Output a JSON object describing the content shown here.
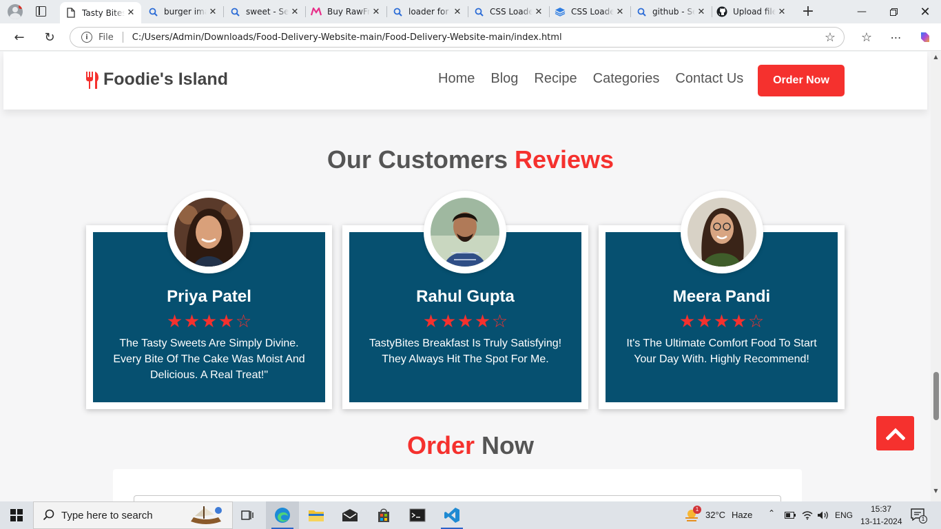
{
  "browser": {
    "tabs": [
      {
        "title": "Tasty Bites",
        "icon": "page-icon",
        "active": true
      },
      {
        "title": "burger ima",
        "icon": "search-icon"
      },
      {
        "title": "sweet - Se",
        "icon": "search-icon"
      },
      {
        "title": "Buy RawFr",
        "icon": "myntra-icon"
      },
      {
        "title": "loader for",
        "icon": "search-icon"
      },
      {
        "title": "CSS Loade",
        "icon": "search-icon"
      },
      {
        "title": "CSS Loade",
        "icon": "layers-icon"
      },
      {
        "title": "github - Se",
        "icon": "search-icon"
      },
      {
        "title": "Upload file",
        "icon": "github-icon"
      }
    ],
    "address": {
      "scheme_label": "File",
      "url": "C:/Users/Admin/Downloads/Food-Delivery-Website-main/Food-Delivery-Website-main/index.html"
    }
  },
  "site": {
    "logo_text": "Foodie's Island",
    "nav": [
      "Home",
      "Blog",
      "Recipe",
      "Categories",
      "Contact Us"
    ],
    "order_button": "Order Now",
    "reviews_title": {
      "plain": "Our Customers ",
      "accent": "Reviews"
    },
    "reviews": [
      {
        "name": "Priya Patel",
        "rating": 4,
        "max": 5,
        "text": "The Tasty Sweets Are Simply Divine. Every Bite Of The Cake Was Moist And Delicious. A Real Treat!\""
      },
      {
        "name": "Rahul Gupta",
        "rating": 4,
        "max": 5,
        "text": "TastyBites Breakfast Is Truly Satisfying! They Always Hit The Spot For Me."
      },
      {
        "name": "Meera Pandi",
        "rating": 4,
        "max": 5,
        "text": "It's The Ultimate Comfort Food To Start Your Day With. Highly Recommend!"
      }
    ],
    "order_title": {
      "accent": "Order",
      "plain": " Now"
    }
  },
  "colors": {
    "accent": "#f5312e",
    "card_blue": "#065070",
    "text_gray": "#555555"
  },
  "taskbar": {
    "search_placeholder": "Type here to search",
    "weather": {
      "temp": "32°C",
      "condition": "Haze",
      "badge": "1"
    },
    "language": "ENG",
    "time": "15:37",
    "date": "13-11-2024",
    "notification_count": "1"
  }
}
